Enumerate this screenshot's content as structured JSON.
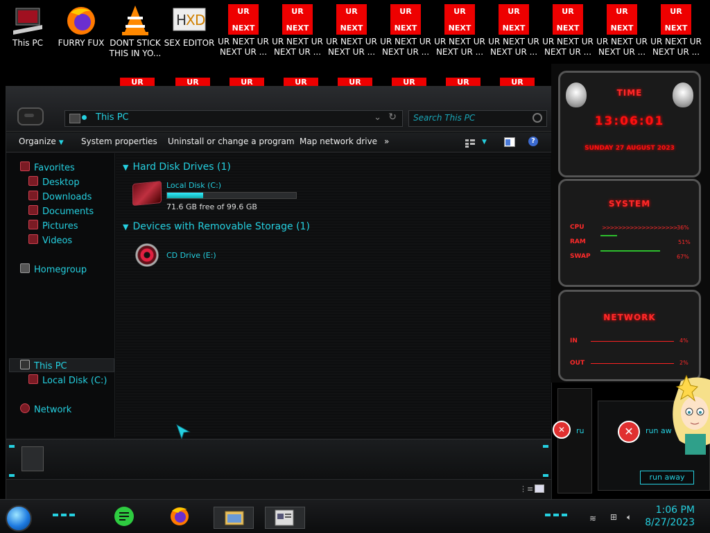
{
  "desktop": {
    "icons": [
      {
        "label": "This PC"
      },
      {
        "label": "FURRY FUX"
      },
      {
        "label": "DONT STICK\nTHIS IN YO..."
      },
      {
        "label": "SEX EDITOR"
      },
      {
        "label": "UR NEXT UR\nNEXT UR ..."
      },
      {
        "label": "UR NEXT UR\nNEXT UR ..."
      },
      {
        "label": "UR NEXT UR\nNEXT UR ..."
      },
      {
        "label": "UR NEXT UR\nNEXT UR ..."
      },
      {
        "label": "UR NEXT UR\nNEXT UR ..."
      },
      {
        "label": "UR NEXT UR\nNEXT UR ..."
      },
      {
        "label": "UR NEXT UR\nNEXT UR ..."
      },
      {
        "label": "UR NEXT UR\nNEXT UR ..."
      },
      {
        "label": "UR NEXT UR\nNEXT UR ..."
      }
    ],
    "ur_top": "UR",
    "ur_bottom": "NEXT"
  },
  "explorer": {
    "breadcrumb": "This PC",
    "search_placeholder": "Search This PC",
    "toolbar": {
      "organize": "Organize",
      "system_properties": "System properties",
      "uninstall": "Uninstall or change a program",
      "map_drive": "Map network drive",
      "more": "»"
    },
    "nav": {
      "favorites": "Favorites",
      "desktop": "Desktop",
      "downloads": "Downloads",
      "documents": "Documents",
      "pictures": "Pictures",
      "videos": "Videos",
      "homegroup": "Homegroup",
      "this_pc": "This PC",
      "local_disk": "Local Disk (C:)",
      "network": "Network"
    },
    "groups": {
      "hdd_title": "Hard Disk Drives (1)",
      "removable_title": "Devices with Removable Storage (1)"
    },
    "drive_c": {
      "name": "Local Disk (C:)",
      "space": "71.6 GB free of 99.6 GB",
      "used_fraction": 0.28
    },
    "drive_e": {
      "name": "CD Drive (E:)"
    }
  },
  "widgets": {
    "time_title": "TIME",
    "time": "13:06:01",
    "date": "SUNDAY 27 AUGUST 2023",
    "system_title": "SYSTEM",
    "cpu_label": "CPU",
    "cpu_value": "36%",
    "ram_label": "RAM",
    "ram_value": "51%",
    "swap_label": "SWAP",
    "swap_value": "67%",
    "network_title": "NETWORK",
    "in_label": "IN",
    "in_value": "4%",
    "out_label": "OUT",
    "out_value": "2%"
  },
  "dialog": {
    "small_text": "ru",
    "message": "run aw",
    "button": "run away"
  },
  "taskbar": {
    "time": "1:06 PM",
    "date": "8/27/2023"
  },
  "colors": {
    "accent": "#25d0e0",
    "widget_red": "#ff2a2a",
    "ur_red": "#e00000"
  }
}
